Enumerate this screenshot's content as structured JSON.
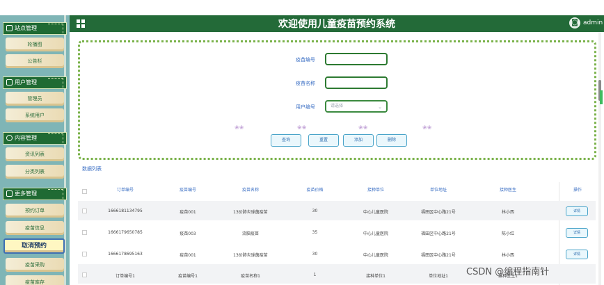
{
  "header": {
    "title": "欢迎使用儿童疫苗预约系统",
    "user": "admin"
  },
  "sidebar": {
    "sections": [
      {
        "label": "站点管理",
        "items": [
          "轮播图",
          "公告栏"
        ]
      },
      {
        "label": "用户管理",
        "items": [
          "管理员",
          "系统用户"
        ]
      },
      {
        "label": "内容管理",
        "items": [
          "资讯列表",
          "分类列表"
        ]
      },
      {
        "label": "更多管理",
        "items": [
          "预约订单",
          "疫苗信息",
          "取消预约",
          "疫苗采购",
          "疫苗库存"
        ]
      }
    ],
    "active": "取消预约"
  },
  "search": {
    "label_code": "疫苗编号",
    "label_name": "疫苗名称",
    "label_user": "用户编号",
    "select_placeholder": "请选择",
    "buttons": [
      "查询",
      "重置",
      "添加",
      "删除"
    ]
  },
  "list_title": "数据列表",
  "table": {
    "headers": [
      "订单编号",
      "疫苗编号",
      "疫苗名称",
      "疫苗价格",
      "接种单位",
      "单位地址",
      "接种医生",
      "操作"
    ],
    "rows": [
      [
        "1666181134795",
        "疫苗001",
        "13价肺炎球菌疫苗",
        "30",
        "中心儿童医院",
        "福田区中心路21号",
        "林小西"
      ],
      [
        "1666179650785",
        "疫苗003",
        "流脑疫苗",
        "35",
        "中心儿童医院",
        "福田区中心路21号",
        "陈小红"
      ],
      [
        "1666178695163",
        "疫苗001",
        "13价肺炎球菌疫苗",
        "30",
        "中心儿童医院",
        "福田区中心路21号",
        "林小西"
      ],
      [
        "订单编号1",
        "疫苗编号1",
        "疫苗名称1",
        "1",
        "接种单位1",
        "单位地址1",
        "接种医生1"
      ]
    ],
    "detail_label": "详情"
  },
  "watermark": "CSDN @编程指南针"
}
